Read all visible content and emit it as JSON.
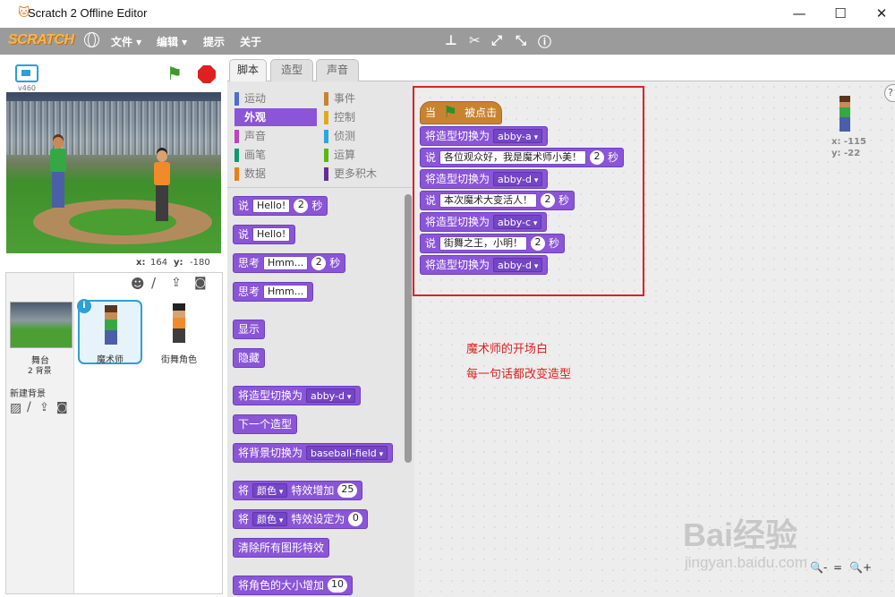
{
  "window": {
    "title": "Scratch 2 Offline Editor",
    "controls": [
      "—",
      "☐",
      "✕"
    ]
  },
  "menubar": {
    "logo": "SCRATCH",
    "items": [
      "文件 ▾",
      "编辑 ▾",
      "提示",
      "关于"
    ]
  },
  "stage": {
    "version": "v460",
    "x_label": "x:",
    "x_value": "164",
    "y_label": "y:",
    "y_value": "-180"
  },
  "sprites": {
    "stage_label": "舞台",
    "stage_count": "2 背景",
    "new_backdrop_label": "新建背景",
    "items": [
      "魔术师",
      "街舞角色"
    ],
    "info_glyph": "i"
  },
  "tabs": [
    "脚本",
    "造型",
    "声音"
  ],
  "categories": [
    {
      "label": "运动",
      "color": "#4a6cd4"
    },
    {
      "label": "事件",
      "color": "#c88330"
    },
    {
      "label": "外观",
      "color": "#8a55d7"
    },
    {
      "label": "控制",
      "color": "#e1a91a"
    },
    {
      "label": "声音",
      "color": "#bb42c3"
    },
    {
      "label": "侦测",
      "color": "#2ca5e2"
    },
    {
      "label": "画笔",
      "color": "#0e9a6c"
    },
    {
      "label": "运算",
      "color": "#5cb712"
    },
    {
      "label": "数据",
      "color": "#ee7d16"
    },
    {
      "label": "更多积木",
      "color": "#632d99"
    }
  ],
  "palette_blocks": {
    "b1": {
      "a": "说",
      "b": "Hello!",
      "c": "2",
      "d": "秒"
    },
    "b2": {
      "a": "说",
      "b": "Hello!"
    },
    "b3": {
      "a": "思考",
      "b": "Hmm...",
      "c": "2",
      "d": "秒"
    },
    "b4": {
      "a": "思考",
      "b": "Hmm..."
    },
    "b5": {
      "a": "显示"
    },
    "b6": {
      "a": "隐藏"
    },
    "b7": {
      "a": "将造型切换为",
      "b": "abby-d"
    },
    "b8": {
      "a": "下一个造型"
    },
    "b9": {
      "a": "将背景切换为",
      "b": "baseball-field"
    },
    "b10": {
      "a": "将",
      "b": "颜色",
      "c": "特效增加",
      "d": "25"
    },
    "b11": {
      "a": "将",
      "b": "颜色",
      "c": "特效设定为",
      "d": "0"
    },
    "b12": {
      "a": "清除所有图形特效"
    },
    "b13": {
      "a": "将角色的大小增加",
      "b": "10"
    }
  },
  "script": {
    "hat": {
      "a": "当",
      "b": "被点击"
    },
    "s1": {
      "a": "将造型切换为",
      "b": "abby-a"
    },
    "s2": {
      "a": "说",
      "b": "各位观众好，我是魔术师小美！",
      "c": "2",
      "d": "秒"
    },
    "s3": {
      "a": "将造型切换为",
      "b": "abby-d"
    },
    "s4": {
      "a": "说",
      "b": "本次魔术大变活人！",
      "c": "2",
      "d": "秒"
    },
    "s5": {
      "a": "将造型切换为",
      "b": "abby-c"
    },
    "s6": {
      "a": "说",
      "b": "街舞之王，小明！",
      "c": "2",
      "d": "秒"
    },
    "s7": {
      "a": "将造型切换为",
      "b": "abby-d"
    }
  },
  "sprite_info": {
    "x": "x: -115",
    "y": "y: -22"
  },
  "notes": [
    "魔术师的开场白",
    "每一句话都改变造型"
  ],
  "watermark": {
    "brand": "Bai经验",
    "url": "jingyan.baidu.com"
  },
  "zoom_controls": [
    "🔍-",
    "=",
    "🔍+"
  ],
  "help_glyph": "?"
}
